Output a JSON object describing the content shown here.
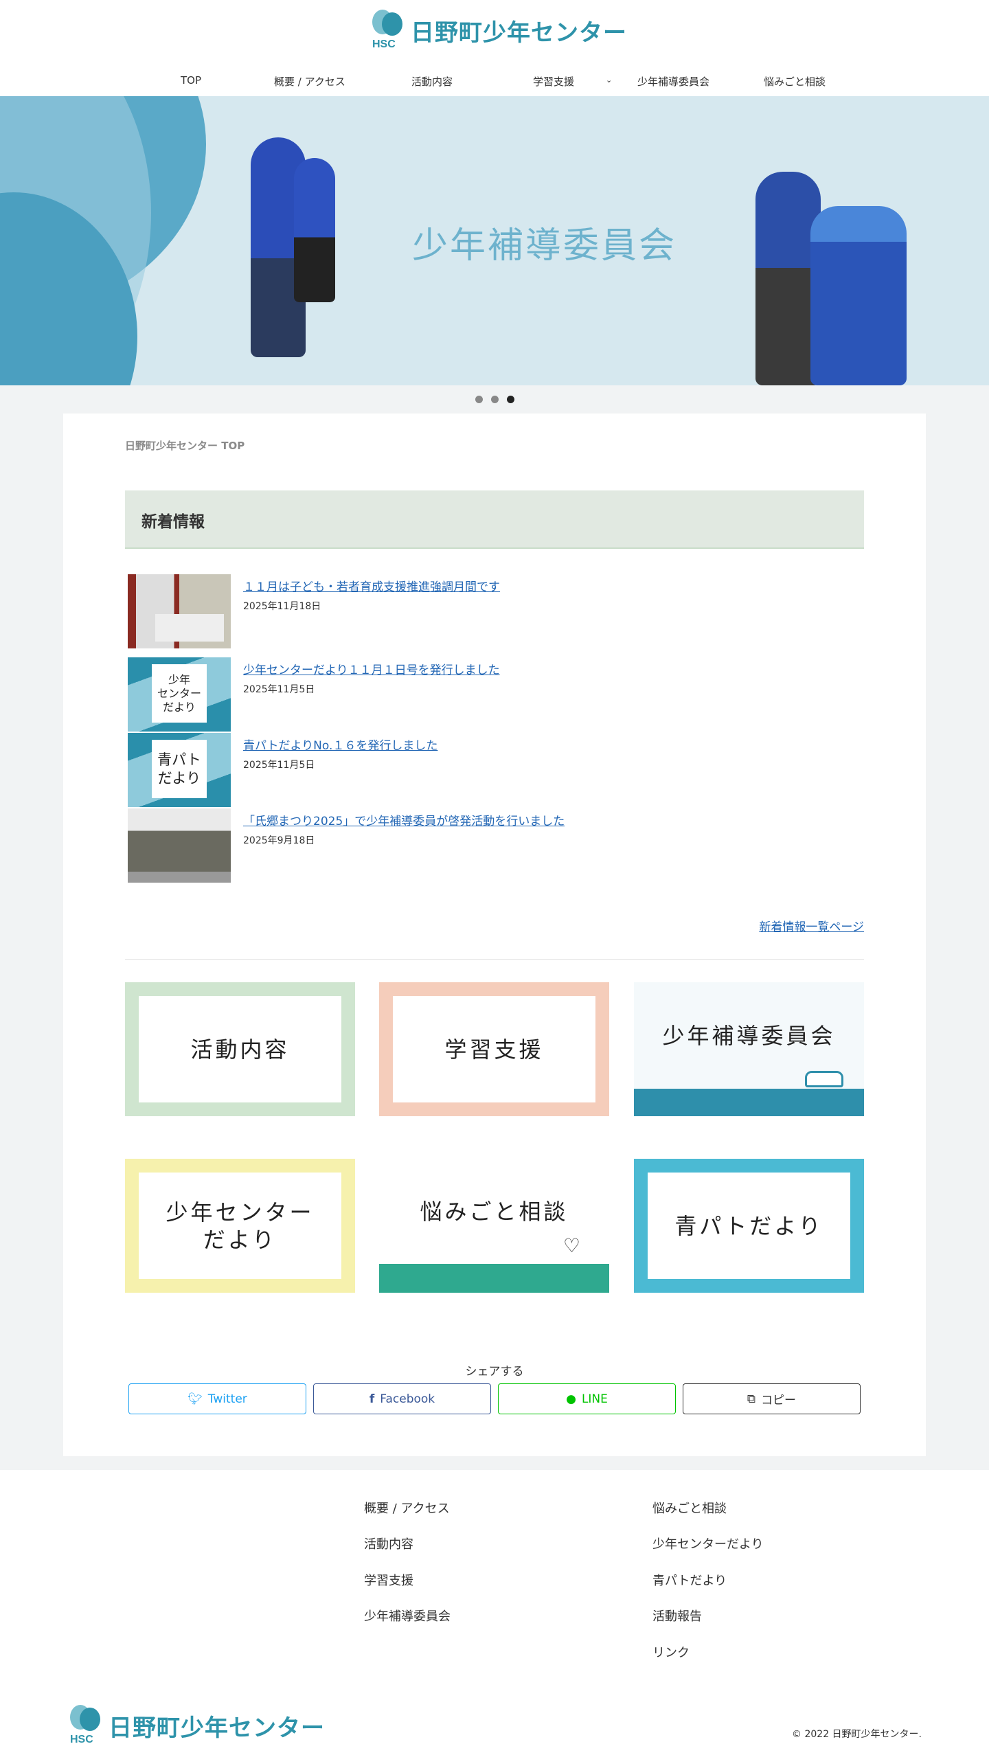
{
  "site": {
    "name": "日野町少年センター",
    "logo_abbr": "HSC"
  },
  "nav": [
    "TOP",
    "概要 / アクセス",
    "活動内容",
    "学習支援",
    "少年補導委員会",
    "悩みごと相談"
  ],
  "nav_dropdown_icon": "chevron-down-icon",
  "hero": {
    "title": "少年補導委員会",
    "slides": 3,
    "active_slide": 3
  },
  "breadcrumb": "日野町少年センター TOP",
  "news": {
    "heading": "新着情報",
    "items": [
      {
        "title": "１１月は子ども・若者育成支援推進強調月間です",
        "date": "2025年11月18日"
      },
      {
        "title": "少年センターだより１１月１日号を発行しました",
        "date": "2025年11月5日",
        "thumb_text": "少年\nセンター\nだより"
      },
      {
        "title": "青パトだよりNo.１６を発行しました",
        "date": "2025年11月5日",
        "thumb_text": "青パト\nだより"
      },
      {
        "title": "「氏郷まつり2025」で少年補導委員が啓発活動を行いました",
        "date": "2025年9月18日"
      }
    ],
    "more_link": "新着情報一覧ページ"
  },
  "tiles": [
    "活動内容",
    "学習支援",
    "少年補導委員会",
    "少年センター\nだより",
    "悩みごと相談",
    "青パトだより"
  ],
  "share": {
    "label": "シェアする",
    "buttons": [
      "Twitter",
      "Facebook",
      "LINE",
      "コピー"
    ]
  },
  "footer": {
    "col1": [
      "概要 / アクセス",
      "活動内容",
      "学習支援",
      "少年補導委員会"
    ],
    "col2": [
      "悩みごと相談",
      "少年センターだより",
      "青パトだより",
      "活動報告",
      "リンク"
    ],
    "copyright": "© 2022 日野町少年センター."
  },
  "colors": {
    "brand": "#2e93aa",
    "link": "#2367b5",
    "twitter": "#1da1f2",
    "facebook": "#3b5998",
    "line": "#00c300"
  }
}
